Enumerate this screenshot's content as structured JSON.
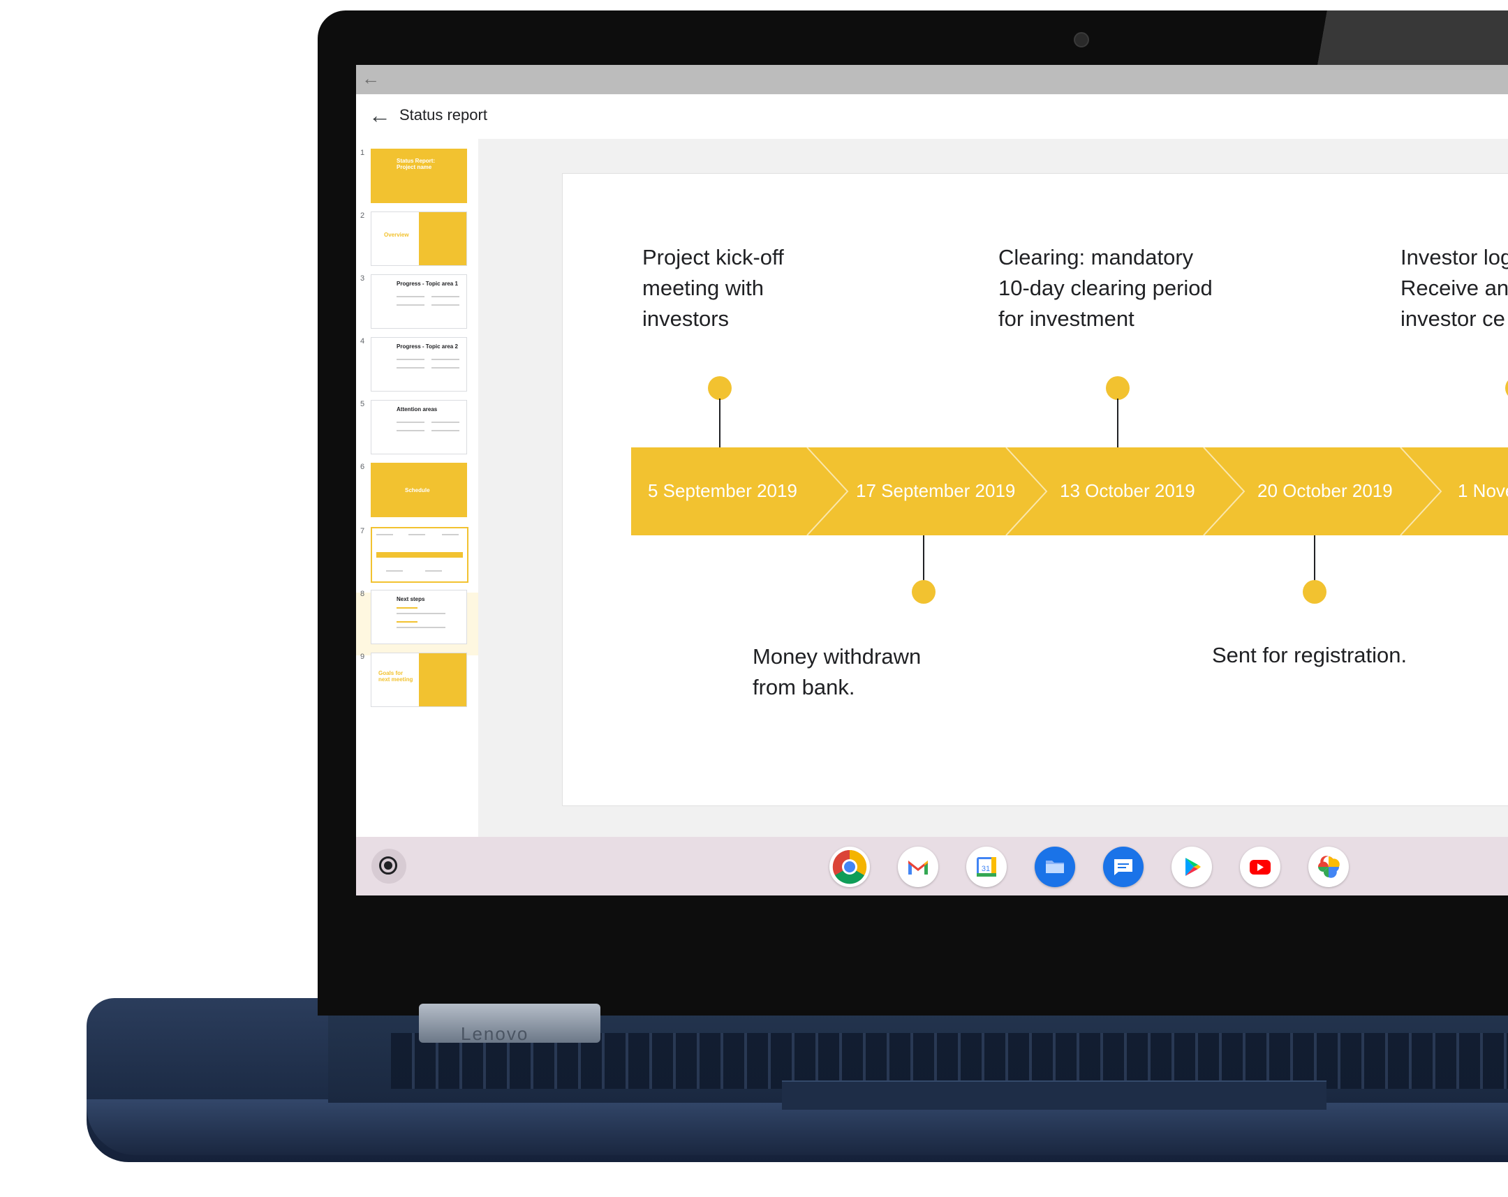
{
  "window": {
    "back_glyph": "←",
    "title": "Status report",
    "toolbar_back_glyph": "←"
  },
  "sidebar": {
    "slides": [
      {
        "number": "1",
        "title": "Status Report: Project name",
        "kind": "title"
      },
      {
        "number": "2",
        "title": "Overview",
        "kind": "split"
      },
      {
        "number": "3",
        "title": "Progress - Topic area 1",
        "kind": "content"
      },
      {
        "number": "4",
        "title": "Progress - Topic area 2",
        "kind": "content"
      },
      {
        "number": "5",
        "title": "Attention areas",
        "kind": "content"
      },
      {
        "number": "6",
        "title": "Schedule",
        "kind": "section"
      },
      {
        "number": "7",
        "title": "",
        "kind": "timeline",
        "selected": true
      },
      {
        "number": "8",
        "title": "Next steps",
        "kind": "content"
      },
      {
        "number": "9",
        "title": "Goals for next meeting",
        "kind": "split"
      }
    ],
    "grid_icon": "grid-icon"
  },
  "slide": {
    "top_labels": [
      "Project kick-off\nmeeting with\ninvestors",
      "Clearing: mandatory\n10-day clearing period\nfor investment",
      "Investor log\nReceive an\ninvestor ce"
    ],
    "dates": [
      "5 September 2019",
      "17 September 2019",
      "13 October 2019",
      "20 October 2019",
      "1 Nove"
    ],
    "bottom_labels": [
      "Money withdrawn\nfrom bank.",
      "Sent for registration."
    ]
  },
  "shelf": {
    "launcher_icon": "launcher-icon",
    "apps": [
      "chrome",
      "gmail",
      "calendar",
      "files",
      "messages",
      "play-store",
      "youtube",
      "photos"
    ],
    "calendar_day": "31"
  },
  "device": {
    "brand": "Lenovo"
  },
  "colors": {
    "accent": "#f2c230",
    "shelf": "#e8dde4",
    "bezel": "#0d0d0d",
    "body": "#1c2b45"
  }
}
